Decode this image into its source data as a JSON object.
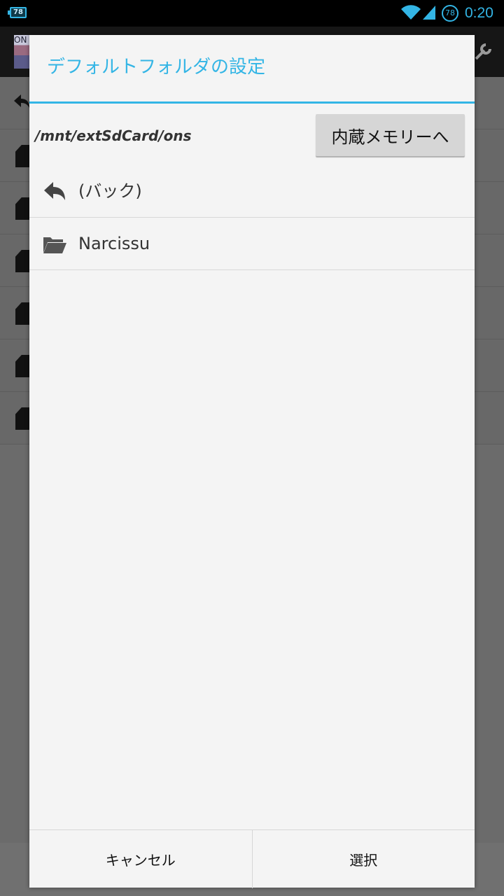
{
  "status_bar": {
    "battery_left": "78",
    "badge": "78",
    "time": "0:20",
    "accent_color": "#33b5e5"
  },
  "background_app": {
    "app_icon_text": "ON",
    "rows": [
      {
        "icon": "back-arrow-icon"
      },
      {
        "icon": "document-icon"
      },
      {
        "icon": "document-icon"
      },
      {
        "icon": "document-icon"
      },
      {
        "icon": "document-icon"
      },
      {
        "icon": "document-icon"
      },
      {
        "icon": "document-icon"
      }
    ]
  },
  "dialog": {
    "title": "デフォルトフォルダの設定",
    "current_path": "/mnt/extSdCard/ons",
    "internal_memory_button": "内蔵メモリーへ",
    "items": [
      {
        "icon": "back-arrow-icon",
        "label": "(バック)"
      },
      {
        "icon": "folder-icon",
        "label": "Narcissu"
      }
    ],
    "cancel_label": "キャンセル",
    "select_label": "選択",
    "title_color": "#33b5e5"
  }
}
